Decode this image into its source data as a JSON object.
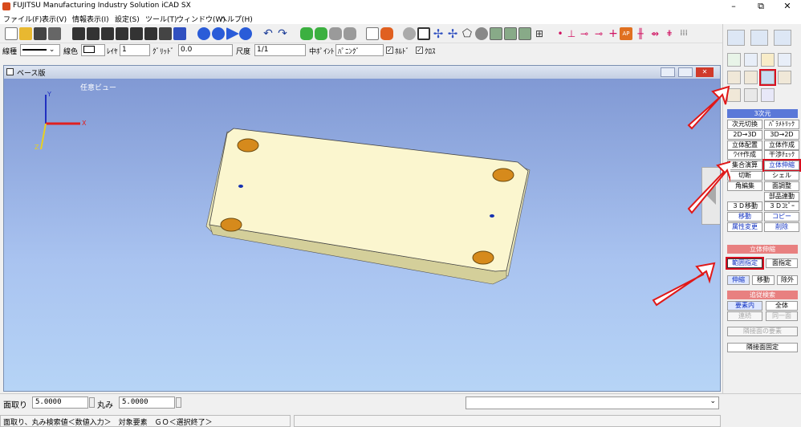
{
  "window": {
    "title": "FUJITSU Manufacturing Industry Solution iCAD SX",
    "min": "–",
    "restore": "⧉",
    "close": "✕"
  },
  "menu": [
    "ファイル(F)",
    "表示(V)",
    "情報表示(I)",
    "設定(S)",
    "ツール(T)",
    "ウィンドウ(W)",
    "ヘルプ(H)"
  ],
  "options": {
    "linetype_label": "線種",
    "color_label": "線色",
    "layer_label": "ﾚｲﾔ",
    "layer_value": "1",
    "grid_label": "ｸﾞﾘｯﾄﾞ",
    "grid_value": "0.0",
    "scale_label": "尺度",
    "scale_value": "1/1",
    "midpoint_label": "中ﾎﾟｲﾝﾄ",
    "midpoint_value": "ﾊﾟﾆﾝｸﾞ",
    "check1": "ﾎﾙﾄﾞ",
    "check2": "ｸﾛｽ"
  },
  "viewport": {
    "title": "ベース版",
    "view_label": "任意ビュー",
    "axis_x": "X",
    "axis_y": "Y",
    "axis_z": "Z"
  },
  "panel": {
    "section_3d": "3次元",
    "buttons": [
      {
        "label": "次元切換",
        "name": "dimension-switch"
      },
      {
        "label": "ﾊﾟﾗﾒﾄﾘｯｸ",
        "name": "parametric"
      },
      {
        "label": "2D→3D",
        "name": "2d-to-3d"
      },
      {
        "label": "3D→2D",
        "name": "3d-to-2d"
      },
      {
        "label": "立体配置",
        "name": "solid-place"
      },
      {
        "label": "立体作成",
        "name": "solid-create"
      },
      {
        "label": "ﾜｲﾔ作成",
        "name": "wire-create"
      },
      {
        "label": "干渉ﾁｪｯｸ",
        "name": "interference-check"
      },
      {
        "label": "集合演算",
        "name": "boolean-op"
      },
      {
        "label": "立体伸縮",
        "name": "solid-stretch"
      },
      {
        "label": "切断",
        "name": "cut"
      },
      {
        "label": "シェル",
        "name": "shell"
      },
      {
        "label": "角編集",
        "name": "corner-edit"
      },
      {
        "label": "面調整",
        "name": "face-adjust"
      },
      {
        "label": "",
        "name": "blank"
      },
      {
        "label": "部品連動",
        "name": "part-link"
      },
      {
        "label": "３Ｄ移動",
        "name": "3d-move"
      },
      {
        "label": "３Ｄｺﾋﾟｰ",
        "name": "3d-copy"
      },
      {
        "label": "移動",
        "name": "move"
      },
      {
        "label": "コピー",
        "name": "copy"
      },
      {
        "label": "属性変更",
        "name": "attr-change"
      },
      {
        "label": "削除",
        "name": "delete"
      }
    ],
    "section_stretch": "立体伸縮",
    "range": "範囲指定",
    "face": "面指定",
    "stretch": "伸縮",
    "move2": "移動",
    "exclude": "除外",
    "section_search": "追従検索",
    "element": "要素内",
    "all": "全体",
    "dis1": "連続",
    "dis2": "同一面",
    "dis3": "隣接面の要素",
    "fixed": "隣接面固定"
  },
  "bottom": {
    "chamfer_label": "面取り",
    "chamfer_value": "5.0000",
    "round_label": "丸み",
    "round_value": "5.0000",
    "status": "面取り、丸み検索値＜数値入力＞　対象要素　ＧＯ＜選択終了＞"
  }
}
